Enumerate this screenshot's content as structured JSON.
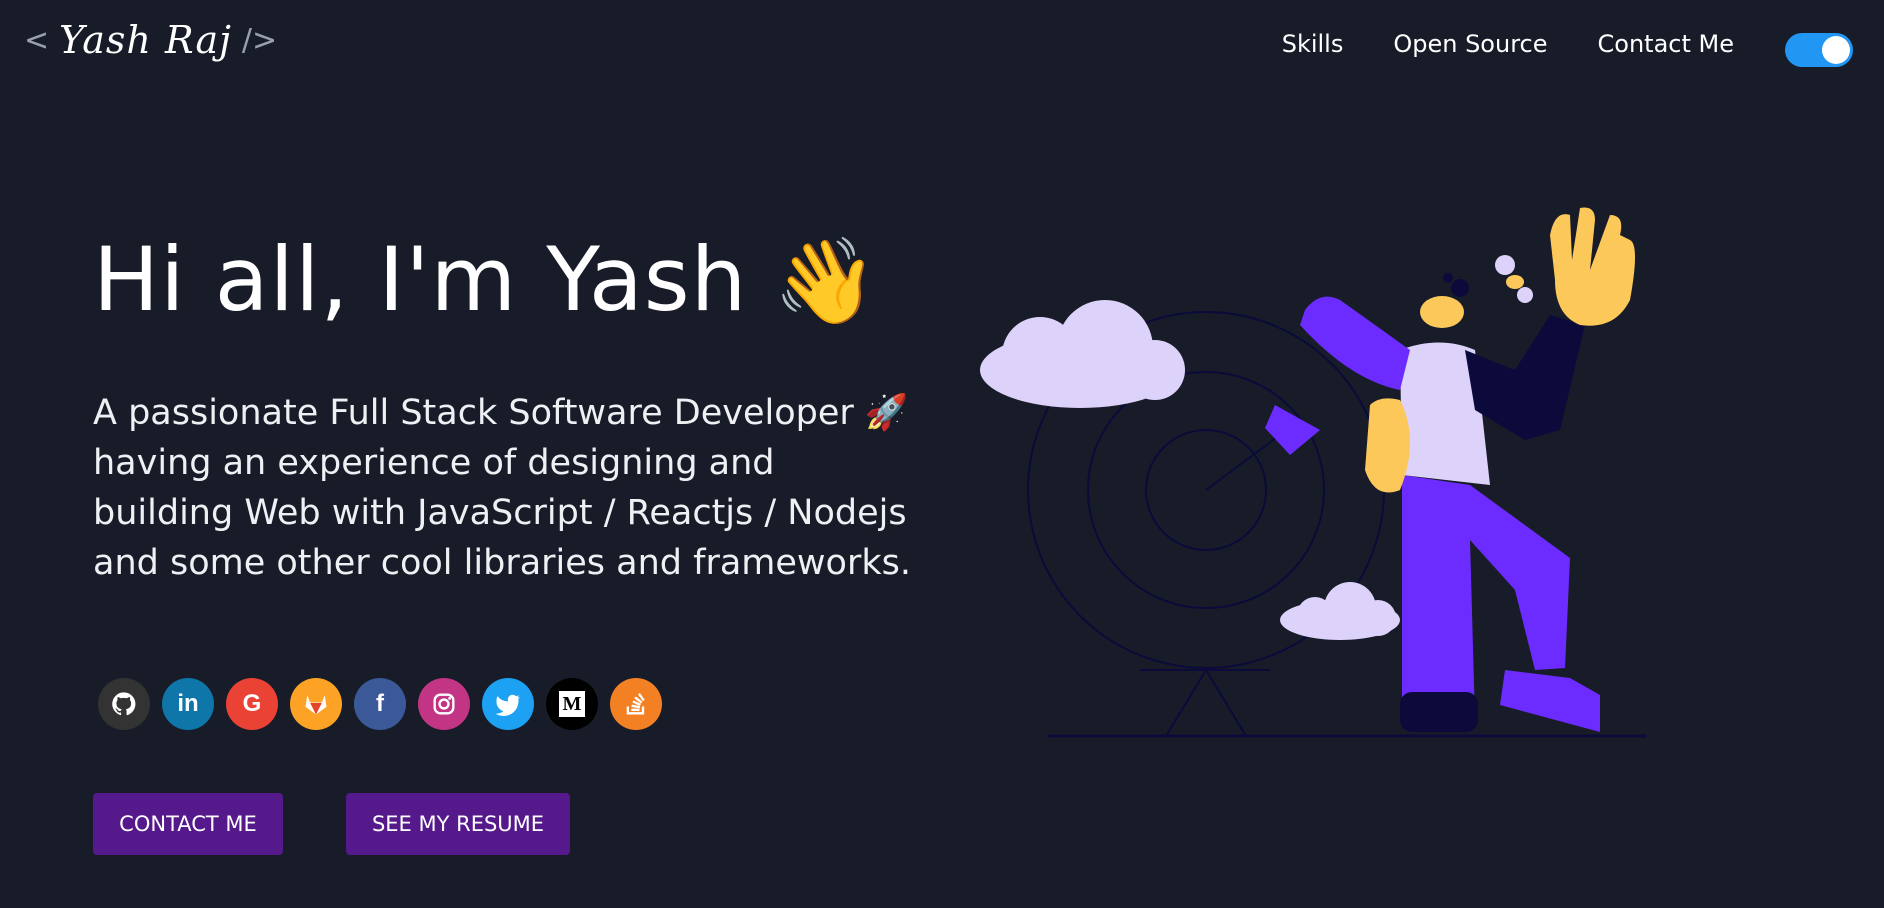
{
  "header": {
    "logo": {
      "open": "<",
      "name": "Yash Raj",
      "close": "/>"
    },
    "nav": [
      {
        "label": "Skills"
      },
      {
        "label": "Open Source"
      },
      {
        "label": "Contact Me"
      }
    ],
    "theme_toggle": {
      "state": "on"
    }
  },
  "hero": {
    "greeting": "Hi all, I'm Yash",
    "wave_emoji": "👋",
    "subtitle": "A passionate Full Stack Software Developer 🚀 having an experience of designing and building Web with JavaScript / Reactjs / Nodejs and some other cool libraries and frameworks.",
    "socials": [
      {
        "name": "github",
        "glyph": "",
        "color": "#333333"
      },
      {
        "name": "linkedin",
        "glyph": "in",
        "color": "#0e76a8"
      },
      {
        "name": "google",
        "glyph": "G",
        "color": "#ea4335"
      },
      {
        "name": "gitlab",
        "glyph": "",
        "color": "#fca326"
      },
      {
        "name": "facebook",
        "glyph": "f",
        "color": "#3b5998"
      },
      {
        "name": "instagram",
        "glyph": "",
        "color": "#c13584"
      },
      {
        "name": "twitter",
        "glyph": "",
        "color": "#1da1f2"
      },
      {
        "name": "medium",
        "glyph": "M",
        "color": "#000000"
      },
      {
        "name": "stackoverflow",
        "glyph": "",
        "color": "#f48024"
      }
    ],
    "buttons": {
      "contact": "CONTACT ME",
      "resume": "SEE MY RESUME"
    }
  },
  "colors": {
    "background": "#171c28",
    "button": "#55198b",
    "toggle": "#2196f3",
    "accent_purple": "#6c2cff",
    "skin": "#fcc85a",
    "lavender": "#dcd2fa"
  }
}
